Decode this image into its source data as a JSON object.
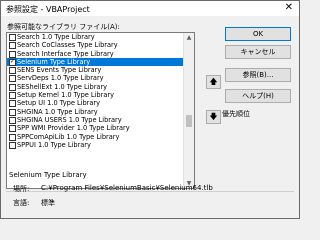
{
  "window": {
    "title": "参照設定 - VBAProject",
    "close_glyph": "✕"
  },
  "list": {
    "label": "参照可能なライブラリ ファイル(A):",
    "items": [
      {
        "label": "Search 1.0 Type Library",
        "checked": false,
        "selected": false
      },
      {
        "label": "Search CoClasses Type Library",
        "checked": false,
        "selected": false
      },
      {
        "label": "Search Interface Type Library",
        "checked": false,
        "selected": false
      },
      {
        "label": "Selenium Type Library",
        "checked": true,
        "selected": true
      },
      {
        "label": "SENS Events Type Library",
        "checked": false,
        "selected": false
      },
      {
        "label": "ServDeps 1.0 Type Library",
        "checked": false,
        "selected": false
      },
      {
        "label": "SEShellExt 1.0 Type Library",
        "checked": false,
        "selected": false
      },
      {
        "label": "Setup Kernel 1.0 Type Library",
        "checked": false,
        "selected": false
      },
      {
        "label": "Setup UI 1.0 Type Library",
        "checked": false,
        "selected": false
      },
      {
        "label": "SHGINA 1.0 Type Library",
        "checked": false,
        "selected": false
      },
      {
        "label": "SHGINA USERS 1.0 Type Library",
        "checked": false,
        "selected": false
      },
      {
        "label": "SPP WMI Provider 1.0 Type Library",
        "checked": false,
        "selected": false
      },
      {
        "label": "SPPComApiLib 1.0 Type Library",
        "checked": false,
        "selected": false
      },
      {
        "label": "SPPUI 1.0 Type Library",
        "checked": false,
        "selected": false
      }
    ]
  },
  "buttons": {
    "ok": "OK",
    "cancel": "キャンセル",
    "browse": "参照(B)...",
    "help": "ヘルプ(H)"
  },
  "priority": {
    "label": "優先順位",
    "up_glyph": "🡅",
    "down_glyph": "🡇"
  },
  "info": {
    "group_title": "Selenium Type Library",
    "location_label": "場所:",
    "location_value": "C:¥Program Files¥SeleniumBasic¥Selenium64.tlb",
    "language_label": "言語:",
    "language_value": "標準"
  },
  "colors": {
    "selection": "#0078d7",
    "ok_border": "#0078d7"
  }
}
